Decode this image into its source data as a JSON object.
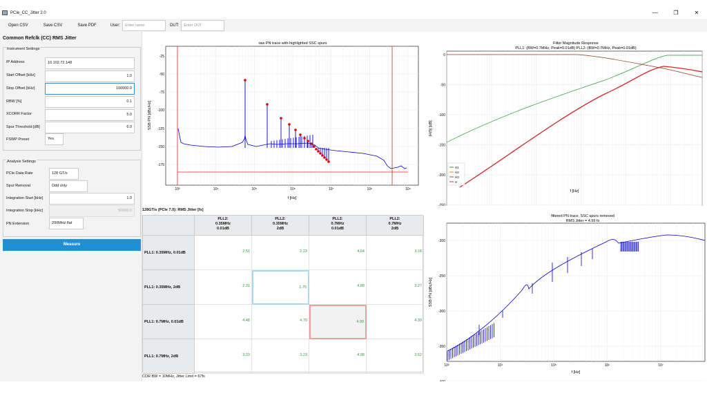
{
  "window": {
    "title": "PCIe_CC_Jitter 2.0",
    "minimize": "—",
    "maximize": "❐",
    "close": "✕"
  },
  "toolbar": {
    "open_csv": "Open CSV",
    "save_csv": "Save CSV",
    "save_pdf": "Save PDF",
    "user_label": "User:",
    "user_placeholder": "Enter name",
    "dut_label": "DUT:",
    "dut_placeholder": "Enter DUT"
  },
  "panel_title": "Common Refclk (CC) RMS Jitter",
  "instrument": {
    "title": "Instrument Settings",
    "ip_label": "IP Address",
    "ip_value": "10.102.72.148",
    "start_label": "Start Offset [kHz]",
    "start_value": "1.0",
    "stop_label": "Stop Offset [kHz]",
    "stop_value": "100000.0",
    "rbw_label": "RBW [%]",
    "rbw_value": "0.1",
    "xcorr_label": "XCORR Factor",
    "xcorr_value": "5.0",
    "spur_label": "Spur Threshold [dB]",
    "spur_value": "6.0",
    "fswp_label": "FSWP Preset",
    "fswp_value": "Yes"
  },
  "analysis": {
    "title": "Analysis Settings",
    "rate_label": "PCIe Data Rate",
    "rate_value": "128 GT/s",
    "spur_removal_label": "Spur Removal",
    "spur_removal_value": "Odd only",
    "int_start_label": "Integration Start [kHz]",
    "int_start_value": "1.0",
    "int_stop_label": "Integration Stop [kHz]",
    "int_stop_value": "50000.0",
    "pn_ext_label": "PN Extension",
    "pn_ext_value": "200MHz flat"
  },
  "measure_label": "Measure",
  "plot1": {
    "title": "raw PN trace with highlighted SSC spurs",
    "xlabel": "f [Hz]",
    "ylabel": "SSB PN [dBc/Hz]",
    "yticks": [
      "-25",
      "-50",
      "-75",
      "-100",
      "-125",
      "-150",
      "-175"
    ],
    "xticks": [
      "10³",
      "10⁴",
      "10⁵",
      "10⁶",
      "10⁷",
      "10⁸",
      "10⁹"
    ]
  },
  "plot2": {
    "title1": "Filter Magnitude Response",
    "title2": "PLL1: (BW=0.7MHz, Peak=0.01dB)   PLL2: (BW=0.7MHz, Peak=0.01dB)",
    "xlabel": "f [Hz]",
    "ylabel": "|H(f)| [dB]",
    "yticks": [
      "0",
      "-50",
      "-100",
      "-150",
      "-200",
      "-250"
    ],
    "xticks": [
      "10³",
      "10⁴",
      "10⁵",
      "10⁶",
      "10⁷",
      "10⁸"
    ],
    "legend": [
      "H1",
      "H2",
      "H3",
      "H"
    ],
    "colors": [
      "#2ca02c",
      "#ff7f0e",
      "#8c564b",
      "#d62728"
    ]
  },
  "plot3": {
    "title1": "filtered PN trace, SSC spurs removed",
    "title2": "RMS Jitter = 4.99 fs",
    "xlabel": "f [Hz]",
    "ylabel": "SSB PN [dBc/Hz]",
    "yticks": [
      "-200",
      "-250",
      "-300",
      "-350",
      "-400"
    ],
    "xticks": [
      "10³",
      "10⁴",
      "10⁵",
      "10⁶",
      "10⁷"
    ]
  },
  "matrix": {
    "title": "128GT/s (PCIe 7.0): RMS Jitter [fs]",
    "cols": [
      [
        "PLL2:",
        "0.35MHz",
        "0.01dB"
      ],
      [
        "PLL2:",
        "0.35MHz",
        "2dB"
      ],
      [
        "PLL2:",
        "0.7MHz",
        "0.01dB"
      ],
      [
        "PLL2:",
        "0.7MHz",
        "2dB"
      ]
    ],
    "rows": [
      {
        "label": "PLL1: 0.35MHz, 0.01dB",
        "values": [
          "2.50",
          "2.23",
          "4.64",
          "3.18"
        ]
      },
      {
        "label": "PLL1: 0.35MHz, 2dB",
        "values": [
          "2.31",
          "1.76",
          "4.88",
          "3.27"
        ]
      },
      {
        "label": "PLL1: 0.7MHz, 0.01dB",
        "values": [
          "4.48",
          "4.70",
          "4.99",
          "4.39"
        ]
      },
      {
        "label": "PLL1: 0.7MHz, 2dB",
        "values": [
          "3.23",
          "3.23",
          "4.88",
          "3.52"
        ]
      }
    ],
    "footer": "CDR BW = 10MHz, Jitter Limit = 67fs"
  }
}
